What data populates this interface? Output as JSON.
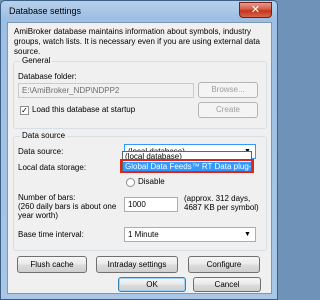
{
  "window": {
    "title": "Database settings",
    "close_glyph": "✕"
  },
  "description": "AmiBroker database maintains information about symbols, industry groups, watch lists. It is necessary even if you are using external data source.",
  "general": {
    "group_label": "General",
    "folder_label": "Database folder:",
    "folder_value": "E:\\AmiBroker_NDP\\NDPP2",
    "browse_label": "Browse...",
    "create_label": "Create",
    "load_checkbox_label": "Load this database at startup",
    "load_checked": true,
    "check_glyph": "✓"
  },
  "data_source": {
    "group_label": "Data source",
    "source_label": "Data source:",
    "source_value": "(local database)",
    "storage_label": "Local data storage:",
    "dropdown_options": [
      "(local database)",
      "Global Data Feeds™ RT Data plug-in"
    ],
    "selected_option_index": 1,
    "disable_label": "Disable",
    "bars_label": "Number of bars:\n(260 daily bars is about one year worth)",
    "bars_label_line1": "Number of bars:",
    "bars_label_line2": "(260 daily bars is about one",
    "bars_label_line3": "year worth)",
    "bars_value": "1000",
    "bars_note_line1": "(approx. 312 days,",
    "bars_note_line2": "4687 KB per symbol)",
    "interval_label": "Base time interval:",
    "interval_value": "1 Minute",
    "dropdown_arrow": "▼"
  },
  "buttons": {
    "flush_cache": "Flush cache",
    "intraday_settings": "Intraday settings",
    "configure": "Configure",
    "ok": "OK",
    "cancel": "Cancel"
  }
}
